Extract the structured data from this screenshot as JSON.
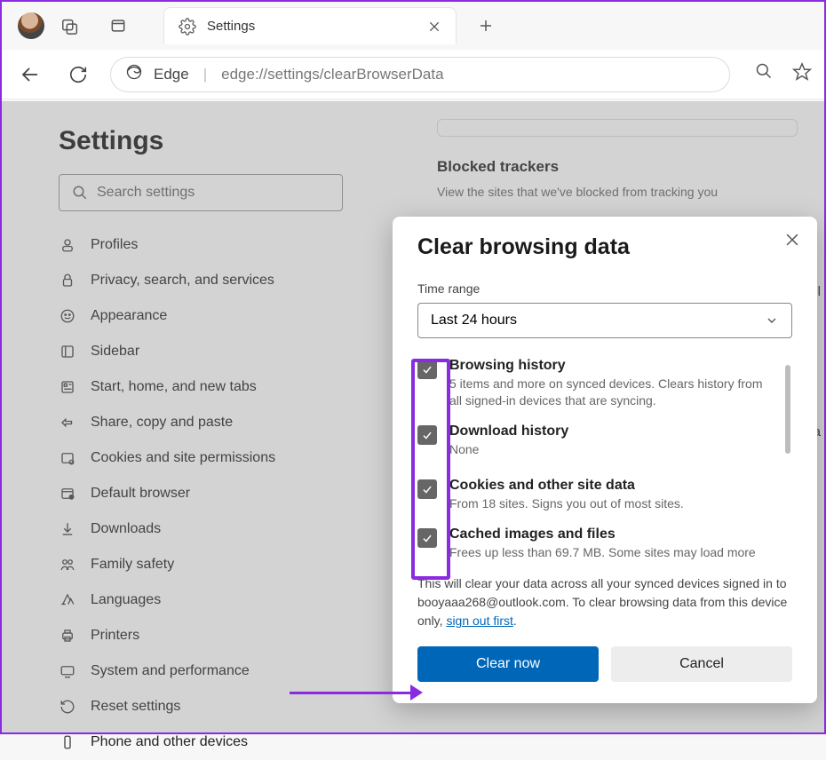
{
  "chrome": {
    "tab_title": "Settings",
    "omnibox_prefix": "Edge",
    "omnibox_url": "edge://settings/clearBrowserData"
  },
  "page": {
    "heading": "Settings",
    "search_placeholder": "Search settings",
    "nav": [
      {
        "label": "Profiles"
      },
      {
        "label": "Privacy, search, and services"
      },
      {
        "label": "Appearance"
      },
      {
        "label": "Sidebar"
      },
      {
        "label": "Start, home, and new tabs"
      },
      {
        "label": "Share, copy and paste"
      },
      {
        "label": "Cookies and site permissions"
      },
      {
        "label": "Default browser"
      },
      {
        "label": "Downloads"
      },
      {
        "label": "Family safety"
      },
      {
        "label": "Languages"
      },
      {
        "label": "Printers"
      },
      {
        "label": "System and performance"
      },
      {
        "label": "Reset settings"
      },
      {
        "label": "Phone and other devices"
      }
    ]
  },
  "main": {
    "section_title": "Blocked trackers",
    "section_desc": "View the sites that we've blocked from tracking you",
    "cutoff1": "nl",
    "cutoff2": "ta"
  },
  "dialog": {
    "title": "Clear browsing data",
    "time_range_label": "Time range",
    "time_range_value": "Last 24 hours",
    "items": [
      {
        "label": "Browsing history",
        "desc": "5 items and more on synced devices. Clears history from all signed-in devices that are syncing."
      },
      {
        "label": "Download history",
        "desc": "None"
      },
      {
        "label": "Cookies and other site data",
        "desc": "From 18 sites. Signs you out of most sites."
      },
      {
        "label": "Cached images and files",
        "desc": "Frees up less than 69.7 MB. Some sites may load more"
      }
    ],
    "footer_note_a": "This will clear your data across all your synced devices signed in to booyaaa268@outlook.com. To clear browsing data from this device only, ",
    "footer_link": "sign out first",
    "footer_note_b": ".",
    "primary": "Clear now",
    "secondary": "Cancel"
  }
}
